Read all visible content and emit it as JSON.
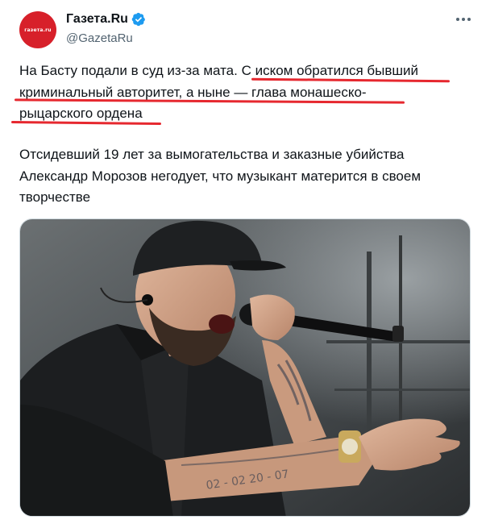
{
  "account": {
    "avatar_text": "газета.ru",
    "display_name": "Газета.Ru",
    "handle": "@GazetaRu",
    "verified": true
  },
  "tweet": {
    "paragraph1_lines": [
      "На Басту подали в суд из-за мата. С иском обратился бывший",
      "криминальный авторитет, а ныне — глава монашеско-",
      "рыцарского ордена"
    ],
    "paragraph2_lines": [
      "Отсидевший 19 лет за вымогательства и заказные убийства",
      "Александр Морозов негодует, что музыкант матерится в своем",
      "творчестве"
    ]
  },
  "media": {
    "description_icon": "photo",
    "tattoo_text": "02 - 02 20 - 07"
  },
  "colors": {
    "accent": "#1d9bf0",
    "underline": "#e6282f",
    "avatar_bg": "#d7202a",
    "text": "#0f1419",
    "secondary": "#536471"
  },
  "icons": {
    "more": "more-horizontal-icon",
    "verified": "verified-badge-icon"
  }
}
